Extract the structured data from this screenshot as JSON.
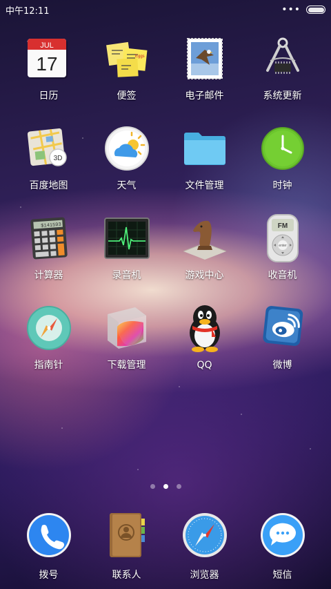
{
  "status_bar": {
    "time": "中午12:11",
    "menu_icon": "more-dots-icon",
    "battery_icon": "battery-icon"
  },
  "apps": [
    {
      "label": "日历",
      "icon": "calendar-icon",
      "calendar_month": "JUL",
      "calendar_day": "17"
    },
    {
      "label": "便签",
      "icon": "notes-icon"
    },
    {
      "label": "电子邮件",
      "icon": "mail-stamp-icon"
    },
    {
      "label": "系统更新",
      "icon": "compass-tool-chip-icon"
    },
    {
      "label": "百度地图",
      "icon": "map-icon",
      "map_badge": "3D"
    },
    {
      "label": "天气",
      "icon": "weather-icon"
    },
    {
      "label": "文件管理",
      "icon": "folder-icon"
    },
    {
      "label": "时钟",
      "icon": "clock-icon"
    },
    {
      "label": "计算器",
      "icon": "calculator-icon",
      "calculator_display": "$141593"
    },
    {
      "label": "录音机",
      "icon": "waveform-monitor-icon"
    },
    {
      "label": "游戏中心",
      "icon": "chess-knight-icon"
    },
    {
      "label": "收音机",
      "icon": "radio-icon",
      "radio_display": "FM",
      "radio_button": "enter"
    },
    {
      "label": "指南针",
      "icon": "compass-icon"
    },
    {
      "label": "下载管理",
      "icon": "gradient-chart-icon"
    },
    {
      "label": "QQ",
      "icon": "penguin-icon"
    },
    {
      "label": "微博",
      "icon": "weibo-icon"
    }
  ],
  "page_indicator": {
    "count": 3,
    "active": 2
  },
  "dock": [
    {
      "label": "拨号",
      "icon": "phone-icon"
    },
    {
      "label": "联系人",
      "icon": "contacts-book-icon"
    },
    {
      "label": "浏览器",
      "icon": "safari-compass-icon"
    },
    {
      "label": "短信",
      "icon": "message-bubble-icon"
    }
  ],
  "colors": {
    "phone_blue": "#2d86f0",
    "clock_green": "#6cc62e",
    "folder_blue": "#5ec3f2",
    "message_blue": "#3aa0f7",
    "calendar_red": "#d8302f"
  }
}
